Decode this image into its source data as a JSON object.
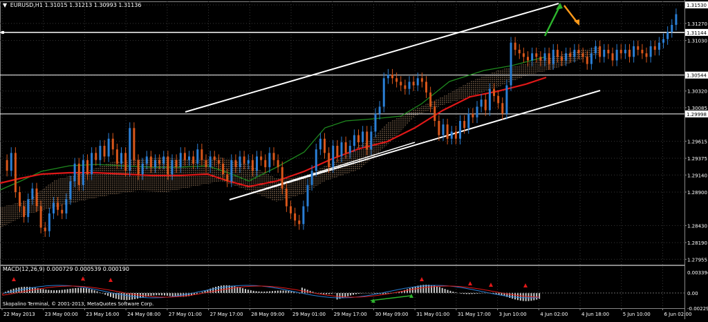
{
  "header": {
    "symbol": "EURUSD,H1",
    "ohlc": "1.31015 1.31213 1.30993 1.31136"
  },
  "macd": {
    "label": "MACD(12,26,9) 0.000729 0.000539 0.000190",
    "tick_labels": [
      "0.003394",
      "0.00",
      "-0.002294"
    ]
  },
  "footer_note": "Skopalino Terminal, © 2001-2013, MetaQuotes Software Corp.",
  "chart_data": {
    "type": "candlestick",
    "y_ticks": [
      "1.31530",
      "1.31270",
      "1.31030",
      "1.30544",
      "1.30320",
      "1.30085",
      "1.29615",
      "1.29375",
      "1.29140",
      "1.28900",
      "1.28430",
      "1.28190",
      "1.27955"
    ],
    "y_tick_values": [
      1.3153,
      1.3127,
      1.3103,
      1.30544,
      1.3032,
      1.30085,
      1.29615,
      1.29375,
      1.2914,
      1.289,
      1.2843,
      1.2819,
      1.27955
    ],
    "price_boxes": [
      {
        "label": "1.31530",
        "value": 1.3153,
        "color": "#ffffff"
      },
      {
        "label": "1.31144",
        "value": 1.31144,
        "color": "#ffffff"
      },
      {
        "label": "1.30544",
        "value": 1.30544,
        "color": "#ffffff"
      },
      {
        "label": "1.29998",
        "value": 1.29998,
        "color": "#ffffff"
      }
    ],
    "ylim": [
      1.2788,
      1.3158
    ],
    "x_ticks": [
      "22 May 2013",
      "23 May 00:00",
      "23 May 16:00",
      "24 May 08:00",
      "27 May 01:00",
      "27 May 17:00",
      "28 May 09:00",
      "29 May 01:00",
      "29 May 17:00",
      "30 May 09:00",
      "31 May 01:00",
      "31 May 17:00",
      "3 Jun 10:00",
      "4 Jun 02:00",
      "4 Jun 18:00",
      "5 Jun 10:00",
      "6 Jun 02:00"
    ],
    "close_path": [
      [
        0,
        1.2935
      ],
      [
        5,
        1.292
      ],
      [
        10,
        1.2945
      ],
      [
        15,
        1.289
      ],
      [
        20,
        1.287
      ],
      [
        25,
        1.2855
      ],
      [
        30,
        1.288
      ],
      [
        35,
        1.2895
      ],
      [
        40,
        1.287
      ],
      [
        45,
        1.284
      ],
      [
        50,
        1.2835
      ],
      [
        55,
        1.286
      ],
      [
        60,
        1.2875
      ],
      [
        65,
        1.2865
      ],
      [
        70,
        1.286
      ],
      [
        75,
        1.288
      ],
      [
        80,
        1.2905
      ],
      [
        85,
        1.293
      ],
      [
        90,
        1.29
      ],
      [
        95,
        1.2935
      ],
      [
        100,
        1.2915
      ],
      [
        105,
        1.2945
      ],
      [
        110,
        1.2935
      ],
      [
        115,
        1.2955
      ],
      [
        120,
        1.294
      ],
      [
        125,
        1.2965
      ],
      [
        130,
        1.295
      ],
      [
        135,
        1.293
      ],
      [
        140,
        1.2945
      ],
      [
        145,
        1.292
      ],
      [
        150,
        1.298
      ],
      [
        155,
        1.2935
      ],
      [
        160,
        1.2915
      ],
      [
        165,
        1.293
      ],
      [
        170,
        1.294
      ],
      [
        175,
        1.2925
      ],
      [
        180,
        1.2935
      ],
      [
        185,
        1.293
      ],
      [
        190,
        1.294
      ],
      [
        195,
        1.2915
      ],
      [
        200,
        1.2935
      ],
      [
        205,
        1.2925
      ],
      [
        210,
        1.2945
      ],
      [
        215,
        1.2935
      ],
      [
        220,
        1.294
      ],
      [
        225,
        1.293
      ],
      [
        230,
        1.295
      ],
      [
        235,
        1.2935
      ],
      [
        240,
        1.2925
      ],
      [
        245,
        1.294
      ],
      [
        250,
        1.2935
      ],
      [
        255,
        1.293
      ],
      [
        260,
        1.2915
      ],
      [
        265,
        1.2905
      ],
      [
        270,
        1.2935
      ],
      [
        275,
        1.2925
      ],
      [
        280,
        1.294
      ],
      [
        285,
        1.293
      ],
      [
        290,
        1.2935
      ],
      [
        295,
        1.292
      ],
      [
        300,
        1.294
      ],
      [
        305,
        1.2935
      ],
      [
        310,
        1.2925
      ],
      [
        315,
        1.2945
      ],
      [
        320,
        1.2935
      ],
      [
        325,
        1.2925
      ],
      [
        330,
        1.2895
      ],
      [
        335,
        1.287
      ],
      [
        340,
        1.286
      ],
      [
        345,
        1.285
      ],
      [
        350,
        1.2845
      ],
      [
        355,
        1.287
      ],
      [
        360,
        1.29
      ],
      [
        365,
        1.292
      ],
      [
        370,
        1.295
      ],
      [
        375,
        1.2965
      ],
      [
        380,
        1.2945
      ],
      [
        385,
        1.2925
      ],
      [
        390,
        1.2955
      ],
      [
        395,
        1.294
      ],
      [
        400,
        1.296
      ],
      [
        405,
        1.2945
      ],
      [
        410,
        1.2955
      ],
      [
        415,
        1.297
      ],
      [
        420,
        1.296
      ],
      [
        425,
        1.2975
      ],
      [
        430,
        1.295
      ],
      [
        435,
        1.2975
      ],
      [
        440,
        1.3
      ],
      [
        445,
        1.301
      ],
      [
        450,
        1.305
      ],
      [
        455,
        1.3055
      ],
      [
        460,
        1.305
      ],
      [
        465,
        1.3045
      ],
      [
        470,
        1.304
      ],
      [
        475,
        1.3035
      ],
      [
        480,
        1.3045
      ],
      [
        485,
        1.304
      ],
      [
        490,
        1.305
      ],
      [
        495,
        1.3045
      ],
      [
        500,
        1.303
      ],
      [
        505,
        1.301
      ],
      [
        510,
        1.299
      ],
      [
        515,
        1.297
      ],
      [
        520,
        1.2985
      ],
      [
        525,
        1.2965
      ],
      [
        530,
        1.2975
      ],
      [
        535,
        1.2965
      ],
      [
        540,
        1.299
      ],
      [
        545,
        1.298
      ],
      [
        550,
        1.3
      ],
      [
        555,
        1.2995
      ],
      [
        560,
        1.301
      ],
      [
        565,
        1.302
      ],
      [
        570,
        1.3005
      ],
      [
        575,
        1.3035
      ],
      [
        580,
        1.3025
      ],
      [
        585,
        1.3015
      ],
      [
        590,
        1.3
      ],
      [
        595,
        1.304
      ],
      [
        600,
        1.31
      ],
      [
        605,
        1.309
      ],
      [
        610,
        1.3085
      ],
      [
        615,
        1.308
      ],
      [
        620,
        1.3075
      ],
      [
        625,
        1.3085
      ],
      [
        630,
        1.308
      ],
      [
        635,
        1.3075
      ],
      [
        640,
        1.3085
      ],
      [
        645,
        1.307
      ],
      [
        650,
        1.309
      ],
      [
        655,
        1.308
      ],
      [
        660,
        1.3075
      ],
      [
        665,
        1.3085
      ],
      [
        670,
        1.308
      ],
      [
        675,
        1.309
      ],
      [
        680,
        1.3085
      ],
      [
        685,
        1.308
      ],
      [
        690,
        1.307
      ],
      [
        695,
        1.3085
      ],
      [
        700,
        1.3095
      ],
      [
        705,
        1.308
      ],
      [
        710,
        1.309
      ],
      [
        715,
        1.3085
      ],
      [
        720,
        1.3075
      ],
      [
        725,
        1.309
      ],
      [
        730,
        1.3085
      ],
      [
        735,
        1.309
      ],
      [
        740,
        1.308
      ],
      [
        745,
        1.3095
      ],
      [
        750,
        1.309
      ],
      [
        755,
        1.3085
      ],
      [
        760,
        1.308
      ],
      [
        765,
        1.3095
      ],
      [
        770,
        1.309
      ],
      [
        775,
        1.31
      ],
      [
        780,
        1.3105
      ],
      [
        785,
        1.3115
      ],
      [
        790,
        1.3125
      ],
      [
        795,
        1.314
      ]
    ]
  }
}
